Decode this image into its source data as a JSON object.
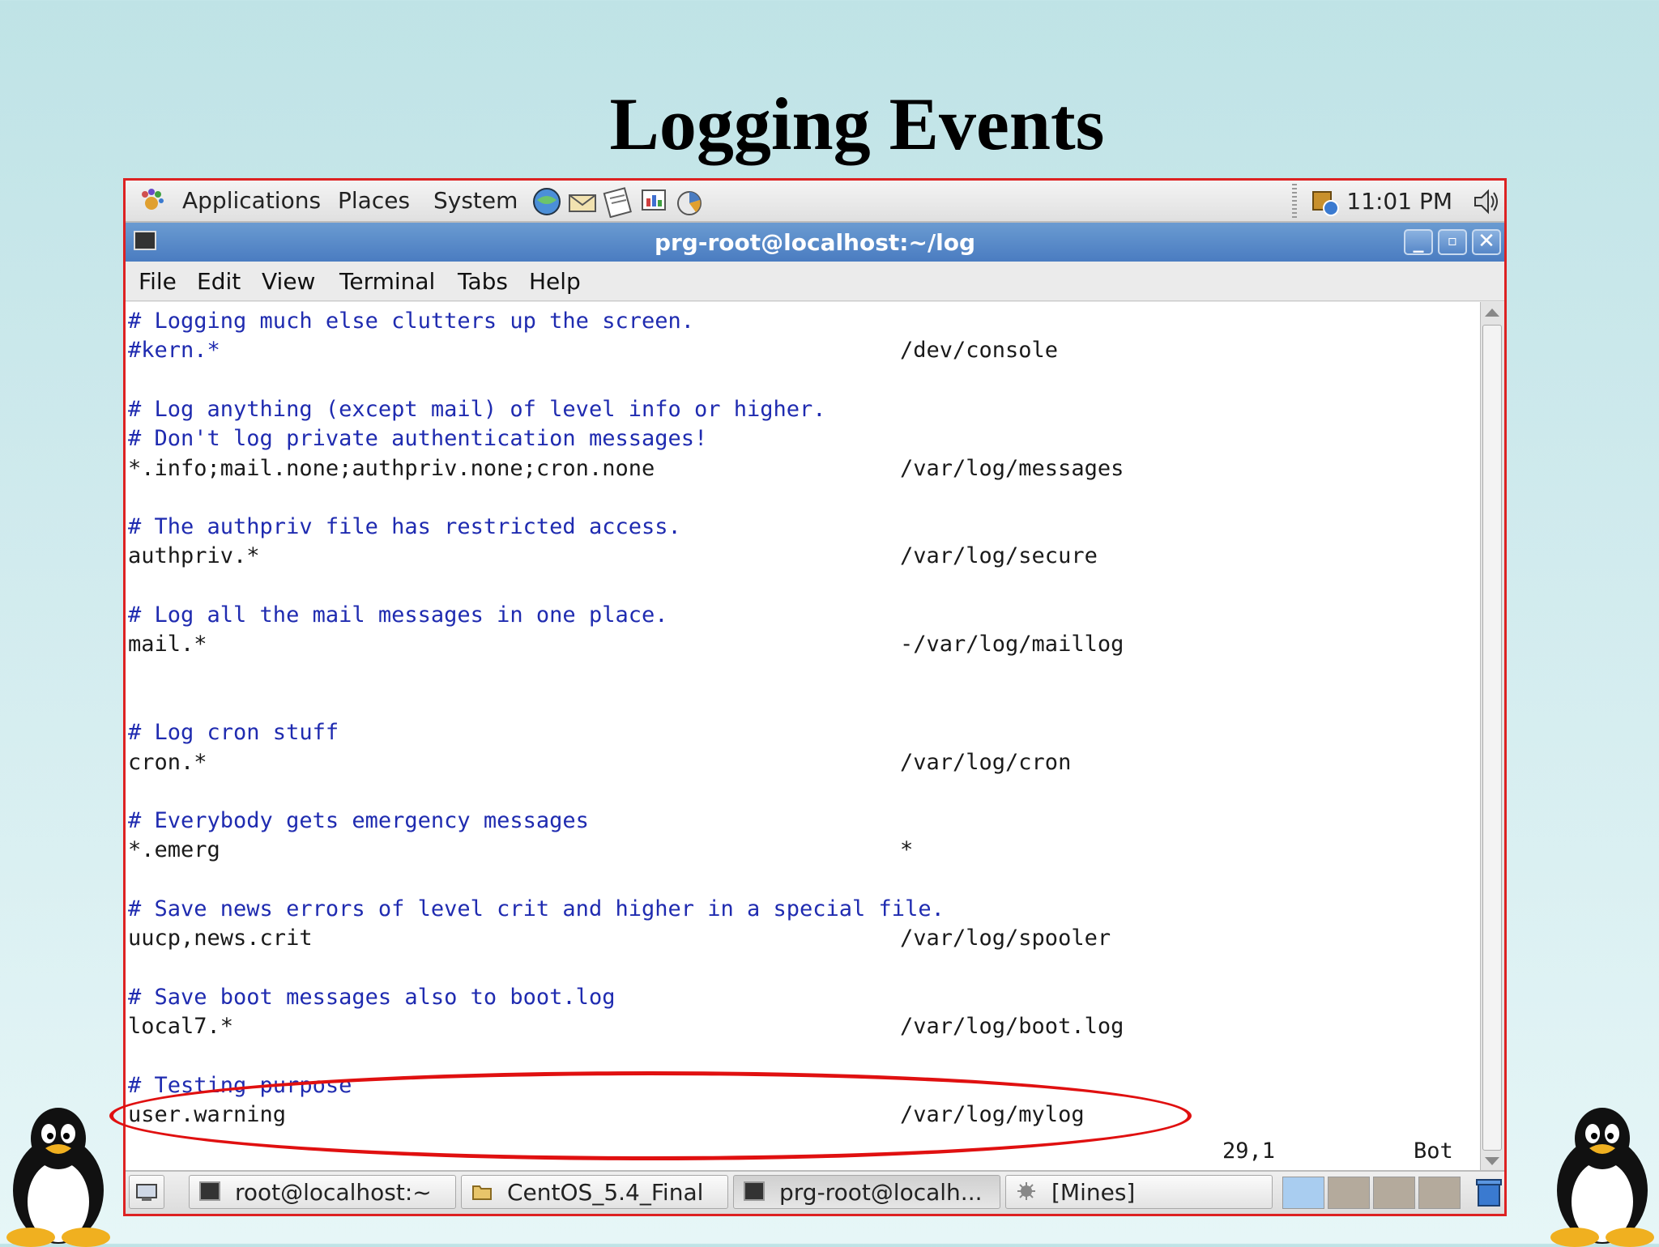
{
  "slide": {
    "title": "Logging Events"
  },
  "panel": {
    "menus": [
      "Applications",
      "Places",
      "System"
    ],
    "launchers": [
      "browser-icon",
      "mail-icon",
      "notes-icon",
      "presentation-icon",
      "tools-icon"
    ],
    "clock": "11:01 PM"
  },
  "window": {
    "title": "prg-root@localhost:~/log",
    "menu": [
      "File",
      "Edit",
      "View",
      "Terminal",
      "Tabs",
      "Help"
    ]
  },
  "terminal": {
    "lines": [
      {
        "left": "# Logging much else clutters up the screen.",
        "right": "",
        "comment": true
      },
      {
        "left": "#kern.*",
        "right": "/dev/console",
        "comment": true
      },
      {
        "left": "",
        "right": "",
        "comment": false
      },
      {
        "left": "# Log anything (except mail) of level info or higher.",
        "right": "",
        "comment": true
      },
      {
        "left": "# Don't log private authentication messages!",
        "right": "",
        "comment": true
      },
      {
        "left": "*.info;mail.none;authpriv.none;cron.none",
        "right": "/var/log/messages",
        "comment": false
      },
      {
        "left": "",
        "right": "",
        "comment": false
      },
      {
        "left": "# The authpriv file has restricted access.",
        "right": "",
        "comment": true
      },
      {
        "left": "authpriv.*",
        "right": "/var/log/secure",
        "comment": false
      },
      {
        "left": "",
        "right": "",
        "comment": false
      },
      {
        "left": "# Log all the mail messages in one place.",
        "right": "",
        "comment": true
      },
      {
        "left": "mail.*",
        "right": "-/var/log/maillog",
        "comment": false
      },
      {
        "left": "",
        "right": "",
        "comment": false
      },
      {
        "left": "",
        "right": "",
        "comment": false
      },
      {
        "left": "# Log cron stuff",
        "right": "",
        "comment": true
      },
      {
        "left": "cron.*",
        "right": "/var/log/cron",
        "comment": false
      },
      {
        "left": "",
        "right": "",
        "comment": false
      },
      {
        "left": "# Everybody gets emergency messages",
        "right": "",
        "comment": true
      },
      {
        "left": "*.emerg",
        "right": "*",
        "comment": false
      },
      {
        "left": "",
        "right": "",
        "comment": false
      },
      {
        "left": "# Save news errors of level crit and higher in a special file.",
        "right": "",
        "comment": true
      },
      {
        "left": "uucp,news.crit",
        "right": "/var/log/spooler",
        "comment": false
      },
      {
        "left": "",
        "right": "",
        "comment": false
      },
      {
        "left": "# Save boot messages also to boot.log",
        "right": "",
        "comment": true
      },
      {
        "left": "local7.*",
        "right": "/var/log/boot.log",
        "comment": false
      },
      {
        "left": "",
        "right": "",
        "comment": false
      },
      {
        "left": "# Testing purpose",
        "right": "",
        "comment": true
      },
      {
        "left": "user.warning",
        "right": "/var/log/mylog",
        "comment": false
      }
    ],
    "status_position": "29,1",
    "status_scroll": "Bot"
  },
  "taskbar": {
    "tasks": [
      {
        "label": "root@localhost:~",
        "icon": "terminal-icon"
      },
      {
        "label": "CentOS_5.4_Final",
        "icon": "folder-icon"
      },
      {
        "label": "prg-root@localh...",
        "icon": "terminal-icon"
      },
      {
        "label": "[Mines]",
        "icon": "mines-icon"
      }
    ]
  },
  "colors": {
    "highlight": "#e01010",
    "comment_text": "#1f2bb0",
    "titlebar": "#5687c8"
  }
}
